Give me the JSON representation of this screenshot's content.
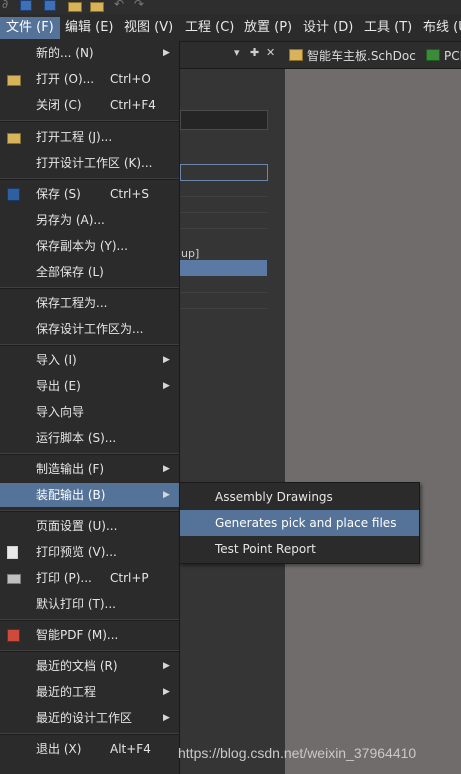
{
  "menubar": {
    "items": [
      "文件 (F)",
      "编辑 (E)",
      "视图 (V)",
      "工程 (C)",
      "放置 (P)",
      "设计 (D)",
      "工具 (T)",
      "布线 (U"
    ]
  },
  "tabs": {
    "schdoc": "智能车主板.SchDoc",
    "pcb": "PCB"
  },
  "panel": {
    "snippet": "up]",
    "controls": [
      "▾",
      "✚",
      "✕"
    ]
  },
  "file_menu": {
    "new": {
      "label": "新的... (N)"
    },
    "open": {
      "label": "打开 (O)...",
      "shortcut": "Ctrl+O"
    },
    "close": {
      "label": "关闭 (C)",
      "shortcut": "Ctrl+F4"
    },
    "open_project": {
      "label": "打开工程 (J)..."
    },
    "open_workspace": {
      "label": "打开设计工作区 (K)..."
    },
    "save": {
      "label": "保存 (S)",
      "shortcut": "Ctrl+S"
    },
    "save_as": {
      "label": "另存为 (A)..."
    },
    "save_copy_as": {
      "label": "保存副本为 (Y)..."
    },
    "save_all": {
      "label": "全部保存 (L)"
    },
    "save_project_as": {
      "label": "保存工程为..."
    },
    "save_workspace_as": {
      "label": "保存设计工作区为..."
    },
    "import": {
      "label": "导入 (I)"
    },
    "export": {
      "label": "导出 (E)"
    },
    "import_wizard": {
      "label": "导入向导"
    },
    "run_script": {
      "label": "运行脚本 (S)..."
    },
    "fabrication_outputs": {
      "label": "制造输出 (F)"
    },
    "assembly_outputs": {
      "label": "装配输出 (B)"
    },
    "page_setup": {
      "label": "页面设置 (U)..."
    },
    "print_preview": {
      "label": "打印预览 (V)..."
    },
    "print": {
      "label": "打印 (P)...",
      "shortcut": "Ctrl+P"
    },
    "default_print": {
      "label": "默认打印 (T)..."
    },
    "smart_pdf": {
      "label": "智能PDF (M)..."
    },
    "recent_docs": {
      "label": "最近的文档 (R)"
    },
    "recent_projects": {
      "label": "最近的工程"
    },
    "recent_workspaces": {
      "label": "最近的设计工作区"
    },
    "exit": {
      "label": "退出 (X)",
      "shortcut": "Alt+F4"
    },
    "arrow": "▶"
  },
  "assembly_submenu": {
    "items": [
      "Assembly Drawings",
      "Generates pick and place files",
      "Test Point Report"
    ]
  },
  "watermark": "https://blog.csdn.net/weixin_37964410",
  "colors": {
    "highlight": "#557398",
    "menu_bg": "#2b2b2b",
    "editor_bg": "#6f6c6b"
  }
}
